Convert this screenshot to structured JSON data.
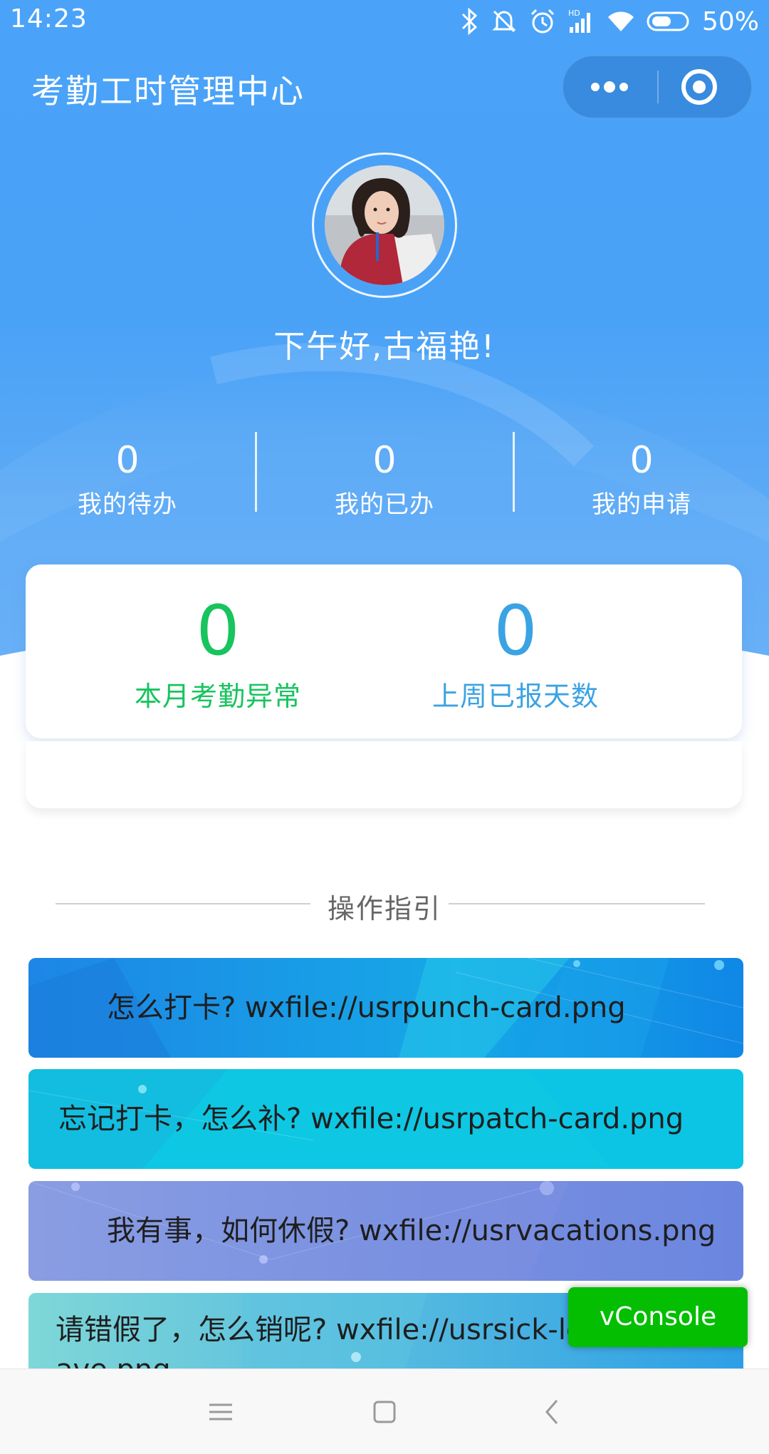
{
  "status_bar": {
    "time": "14:23",
    "battery": "50%",
    "icons": [
      "bluetooth-icon",
      "mute-icon",
      "alarm-icon",
      "hd-signal-icon",
      "wifi-icon",
      "battery-icon"
    ]
  },
  "header": {
    "title": "考勤工时管理中心",
    "capsule_icons": [
      "more-icon",
      "close-target-icon"
    ]
  },
  "profile": {
    "greeting": "下午好,古福艳!"
  },
  "counters": [
    {
      "value": "0",
      "label": "我的待办"
    },
    {
      "value": "0",
      "label": "我的已办"
    },
    {
      "value": "0",
      "label": "我的申请"
    }
  ],
  "stats": [
    {
      "value": "0",
      "label": "本月考勤异常",
      "color": "#17c45e"
    },
    {
      "value": "0",
      "label": "上周已报天数",
      "color": "#3aa3e3"
    }
  ],
  "guide_section": {
    "title": "操作指引",
    "items": [
      {
        "label": "怎么打卡? wxfile://usrpunch-card.png"
      },
      {
        "label": "忘记打卡，怎么补? wxfile://usrpatch-card.png"
      },
      {
        "label": "我有事，如何休假? wxfile://usrvacations.png"
      },
      {
        "label": "请错假了，怎么销呢? wxfile://usrsick-leave.png"
      }
    ]
  },
  "vconsole": {
    "label": "vConsole"
  },
  "nav_bar": {
    "icons": [
      "menu-icon",
      "home-icon",
      "back-icon"
    ]
  },
  "colors": {
    "header_blue": "#4aa3f8",
    "vconsole_green": "#04be02"
  }
}
